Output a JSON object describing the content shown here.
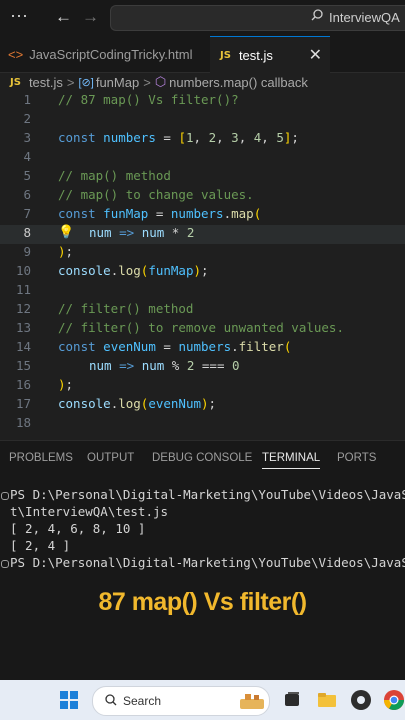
{
  "titlebar": {
    "search_text": "InterviewQA",
    "icons": [
      "menu-dots-icon",
      "back-arrow-icon",
      "forward-arrow-icon",
      "search-icon"
    ]
  },
  "tabs": [
    {
      "label": "JavaScriptCodingTricky.html",
      "icon": "html-code-icon"
    },
    {
      "label": "test.js",
      "icon": "js-file-icon",
      "icon_text": "JS",
      "close": "✕"
    }
  ],
  "breadcrumbs": {
    "file": "test.js",
    "file_icon_text": "JS",
    "symbol": "funMap",
    "method": "numbers.map() callback",
    "separator": ">"
  },
  "editor": {
    "active_line": 8,
    "lines": [
      {
        "n": "1"
      },
      {
        "n": "2"
      },
      {
        "n": "3"
      },
      {
        "n": "4"
      },
      {
        "n": "5"
      },
      {
        "n": "6"
      },
      {
        "n": "7"
      },
      {
        "n": "8"
      },
      {
        "n": "9"
      },
      {
        "n": "10"
      },
      {
        "n": "11"
      },
      {
        "n": "12"
      },
      {
        "n": "13"
      },
      {
        "n": "14"
      },
      {
        "n": "15"
      },
      {
        "n": "16"
      },
      {
        "n": "17"
      },
      {
        "n": "18"
      }
    ],
    "tokens": {
      "l1": "// 87 map() Vs filter()?",
      "l3_const": "const",
      "l3_name": "numbers",
      "l3_eq": " = ",
      "l3_open": "[",
      "l3_nums": [
        "1",
        "2",
        "3",
        "4",
        "5"
      ],
      "l3_comma": ", ",
      "l3_close": "]",
      "l3_semi": ";",
      "l5": "// map() method",
      "l6": "// map() to change values.",
      "l7_const": "const",
      "l7_name": "funMap",
      "l7_eq": " = ",
      "l7_obj": "numbers",
      "l7_dot": ".",
      "l7_fn": "map",
      "l7_paren": "(",
      "l8_param": "num",
      "l8_arrow": " => ",
      "l8_var": "num",
      "l8_op": " * ",
      "l8_num": "2",
      "l9_paren": ")",
      "l9_semi": ";",
      "l10_obj": "console",
      "l10_dot": ".",
      "l10_fn": "log",
      "l10_open": "(",
      "l10_arg": "funMap",
      "l10_close": ")",
      "l10_semi": ";",
      "l12": "// filter() method",
      "l13": "// filter() to remove unwanted values.",
      "l14_const": "const",
      "l14_name": "evenNum",
      "l14_eq": " = ",
      "l14_obj": "numbers",
      "l14_dot": ".",
      "l14_fn": "filter",
      "l14_paren": "(",
      "l15_param": "num",
      "l15_arrow": " => ",
      "l15_var": "num",
      "l15_op1": " % ",
      "l15_num1": "2",
      "l15_op2": " === ",
      "l15_num2": "0",
      "l16_paren": ")",
      "l16_semi": ";",
      "l17_obj": "console",
      "l17_dot": ".",
      "l17_fn": "log",
      "l17_open": "(",
      "l17_arg": "evenNum",
      "l17_close": ")",
      "l17_semi": ";"
    }
  },
  "panel": {
    "tabs": [
      "PROBLEMS",
      "OUTPUT",
      "DEBUG CONSOLE",
      "TERMINAL",
      "PORTS"
    ],
    "active_tab": "TERMINAL",
    "terminal_lines": [
      "PS D:\\Personal\\Digital-Marketing\\YouTube\\Videos\\JavaSc",
      "t\\InterviewQA\\test.js",
      "[ 2, 4, 6, 8, 10 ]",
      "[ 2, 4 ]",
      "PS D:\\Personal\\Digital-Marketing\\YouTube\\Videos\\JavaSc"
    ]
  },
  "caption": "87 map() Vs filter()",
  "taskbar": {
    "search_placeholder": "Search",
    "icons": [
      "windows-start-icon",
      "search-icon",
      "task-view-icon",
      "file-explorer-icon",
      "obs-icon",
      "chrome-icon"
    ]
  },
  "colors": {
    "accent": "#0078d4",
    "caption": "#f1b82d",
    "comment": "#6a9955",
    "keyword": "#569cd6",
    "number": "#b5cea8"
  }
}
